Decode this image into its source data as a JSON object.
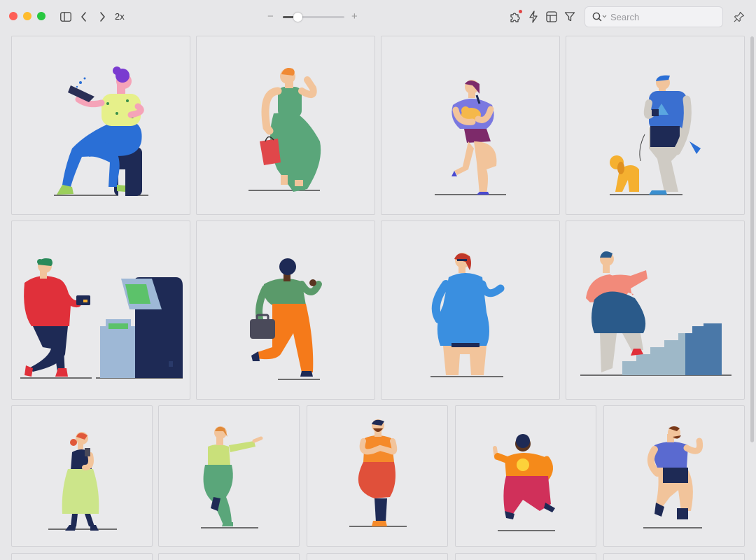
{
  "toolbar": {
    "zoom_label": "2x",
    "slider_minus": "−",
    "slider_plus": "+",
    "zoom_slider_value": 0.2,
    "search": {
      "placeholder": "Search",
      "value": ""
    }
  },
  "icons": {
    "sidebar_toggle": "sidebar-icon",
    "back": "chevron-left-icon",
    "forward": "chevron-right-icon",
    "extensions": "puzzle-icon",
    "actions": "lightning-icon",
    "layout": "layout-icon",
    "filter": "filter-icon",
    "search": "magnifier-icon",
    "pin": "pin-icon"
  },
  "colors": {
    "close": "#fe5f57",
    "minimize": "#febc2e",
    "maximize": "#28c840",
    "background": "#e7e7e9"
  },
  "gallery": {
    "rows": [
      {
        "items": [
          "woman-laptop",
          "woman-shopping-bag",
          "woman-holding-cat",
          "man-walking-dog"
        ]
      },
      {
        "items": [
          "woman-atm-card",
          "man-briefcase",
          "woman-blue-dress",
          "woman-climbing-stairs"
        ]
      },
      {
        "items": [
          "woman-phone-skirt",
          "woman-pointing-green",
          "man-yoga-pose",
          "man-orange-jumping",
          "man-blue-shirt"
        ]
      }
    ]
  }
}
